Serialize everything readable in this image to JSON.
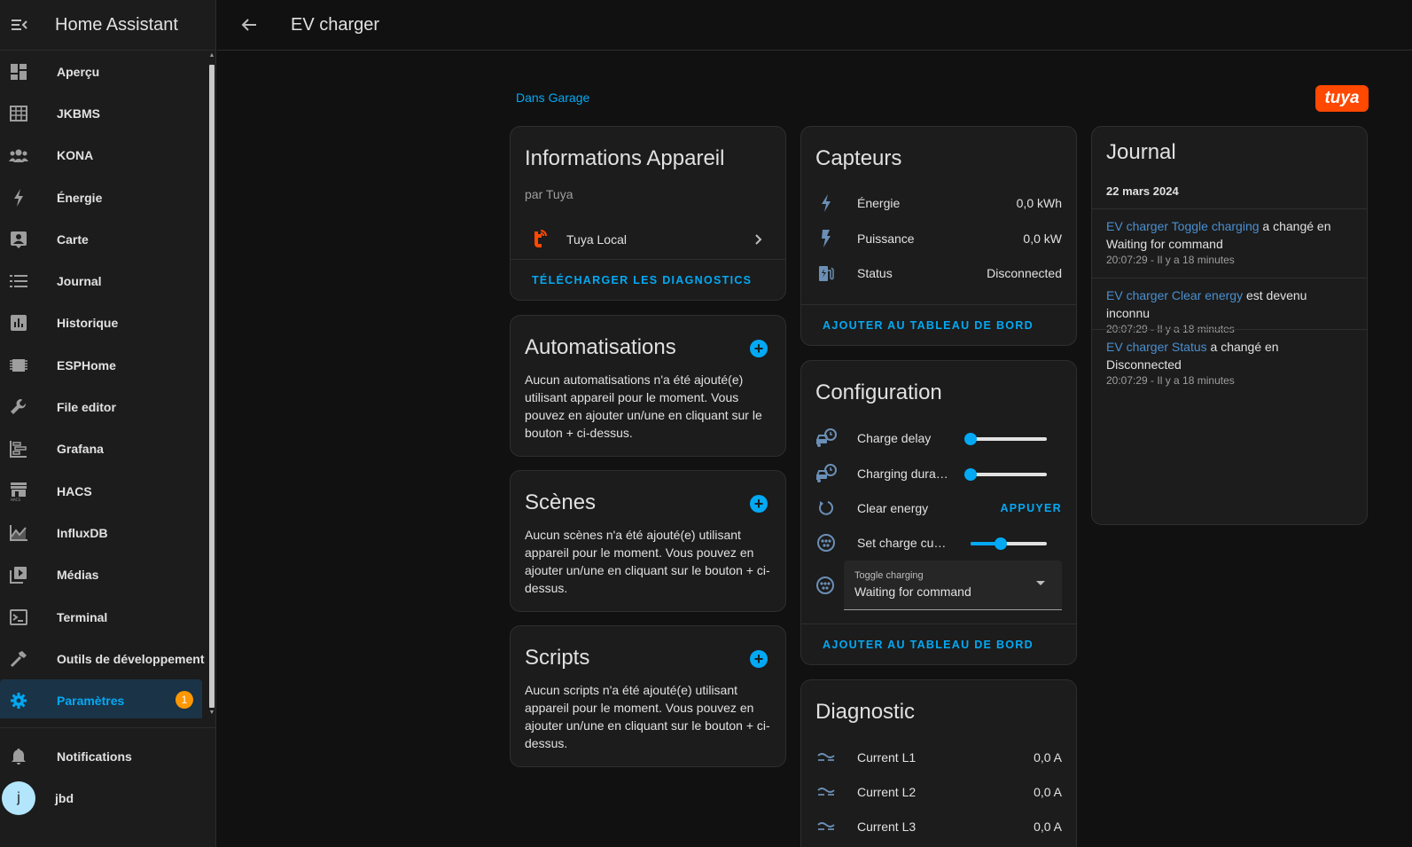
{
  "app": {
    "title": "Home Assistant"
  },
  "sidebar": {
    "items": [
      {
        "label": "Aperçu",
        "icon": "dashboard-icon"
      },
      {
        "label": "JKBMS",
        "icon": "table-icon"
      },
      {
        "label": "KONA",
        "icon": "group-icon"
      },
      {
        "label": "Énergie",
        "icon": "lightning-icon"
      },
      {
        "label": "Carte",
        "icon": "map-person-icon"
      },
      {
        "label": "Journal",
        "icon": "list-icon"
      },
      {
        "label": "Historique",
        "icon": "chart-bar-icon"
      },
      {
        "label": "ESPHome",
        "icon": "chip-icon"
      },
      {
        "label": "File editor",
        "icon": "wrench-icon"
      },
      {
        "label": "Grafana",
        "icon": "gantt-icon"
      },
      {
        "label": "HACS",
        "icon": "store-icon"
      },
      {
        "label": "InfluxDB",
        "icon": "area-chart-icon"
      },
      {
        "label": "Médias",
        "icon": "play-box-icon"
      },
      {
        "label": "Terminal",
        "icon": "terminal-icon"
      },
      {
        "label": "Outils de développement",
        "icon": "hammer-icon"
      },
      {
        "label": "Paramètres",
        "icon": "gear-icon",
        "active": true,
        "badge": "1"
      }
    ],
    "notifications": "Notifications",
    "user": {
      "name": "jbd",
      "initial": "j"
    }
  },
  "header": {
    "title": "EV charger"
  },
  "breadcrumb": "Dans Garage",
  "brand_logo": "tuya",
  "device_info": {
    "title": "Informations Appareil",
    "subtitle": "par Tuya",
    "integration": "Tuya Local",
    "action": "TÉLÉCHARGER LES DIAGNOSTICS"
  },
  "automations": {
    "title": "Automatisations",
    "text": "Aucun automatisations n'a été ajouté(e) utilisant appareil pour le moment. Vous pouvez en ajouter un/une en cliquant sur le bouton + ci-dessus."
  },
  "scenes": {
    "title": "Scènes",
    "text": "Aucun scènes n'a été ajouté(e) utilisant appareil pour le moment. Vous pouvez en ajouter un/une en cliquant sur le bouton + ci-dessus."
  },
  "scripts": {
    "title": "Scripts",
    "text": "Aucun scripts n'a été ajouté(e) utilisant appareil pour le moment. Vous pouvez en ajouter un/une en cliquant sur le bouton + ci-dessus."
  },
  "sensors": {
    "title": "Capteurs",
    "rows": [
      {
        "name": "Énergie",
        "value": "0,0 kWh"
      },
      {
        "name": "Puissance",
        "value": "0,0 kW"
      },
      {
        "name": "Status",
        "value": "Disconnected"
      }
    ],
    "action": "AJOUTER AU TABLEAU DE BORD"
  },
  "configuration": {
    "title": "Configuration",
    "charge_delay": {
      "name": "Charge delay",
      "level": 0
    },
    "charging_duration": {
      "name": "Charging dura…",
      "level": 0
    },
    "clear_energy": {
      "name": "Clear energy",
      "button": "APPUYER"
    },
    "set_charge_current": {
      "name": "Set charge cu…",
      "level": 0.4
    },
    "toggle_charging": {
      "label": "Toggle charging",
      "value": "Waiting for command"
    },
    "action": "AJOUTER AU TABLEAU DE BORD"
  },
  "diagnostic": {
    "title": "Diagnostic",
    "rows": [
      {
        "name": "Current L1",
        "value": "0,0 A"
      },
      {
        "name": "Current L2",
        "value": "0,0 A"
      },
      {
        "name": "Current L3",
        "value": "0,0 A"
      }
    ]
  },
  "logbook": {
    "title": "Journal",
    "date": "22 mars 2024",
    "entries": [
      {
        "entity": "EV charger Toggle charging",
        "text": " a changé en Waiting for command",
        "time": "20:07:29 - Il y a 18 minutes"
      },
      {
        "entity": "EV charger Clear energy",
        "text": " est devenu inconnu",
        "time": "20:07:29 - Il y a 18 minutes"
      },
      {
        "entity": "EV charger Status",
        "text": " a changé en Disconnected",
        "time": "20:07:29 - Il y a 18 minutes"
      }
    ]
  }
}
